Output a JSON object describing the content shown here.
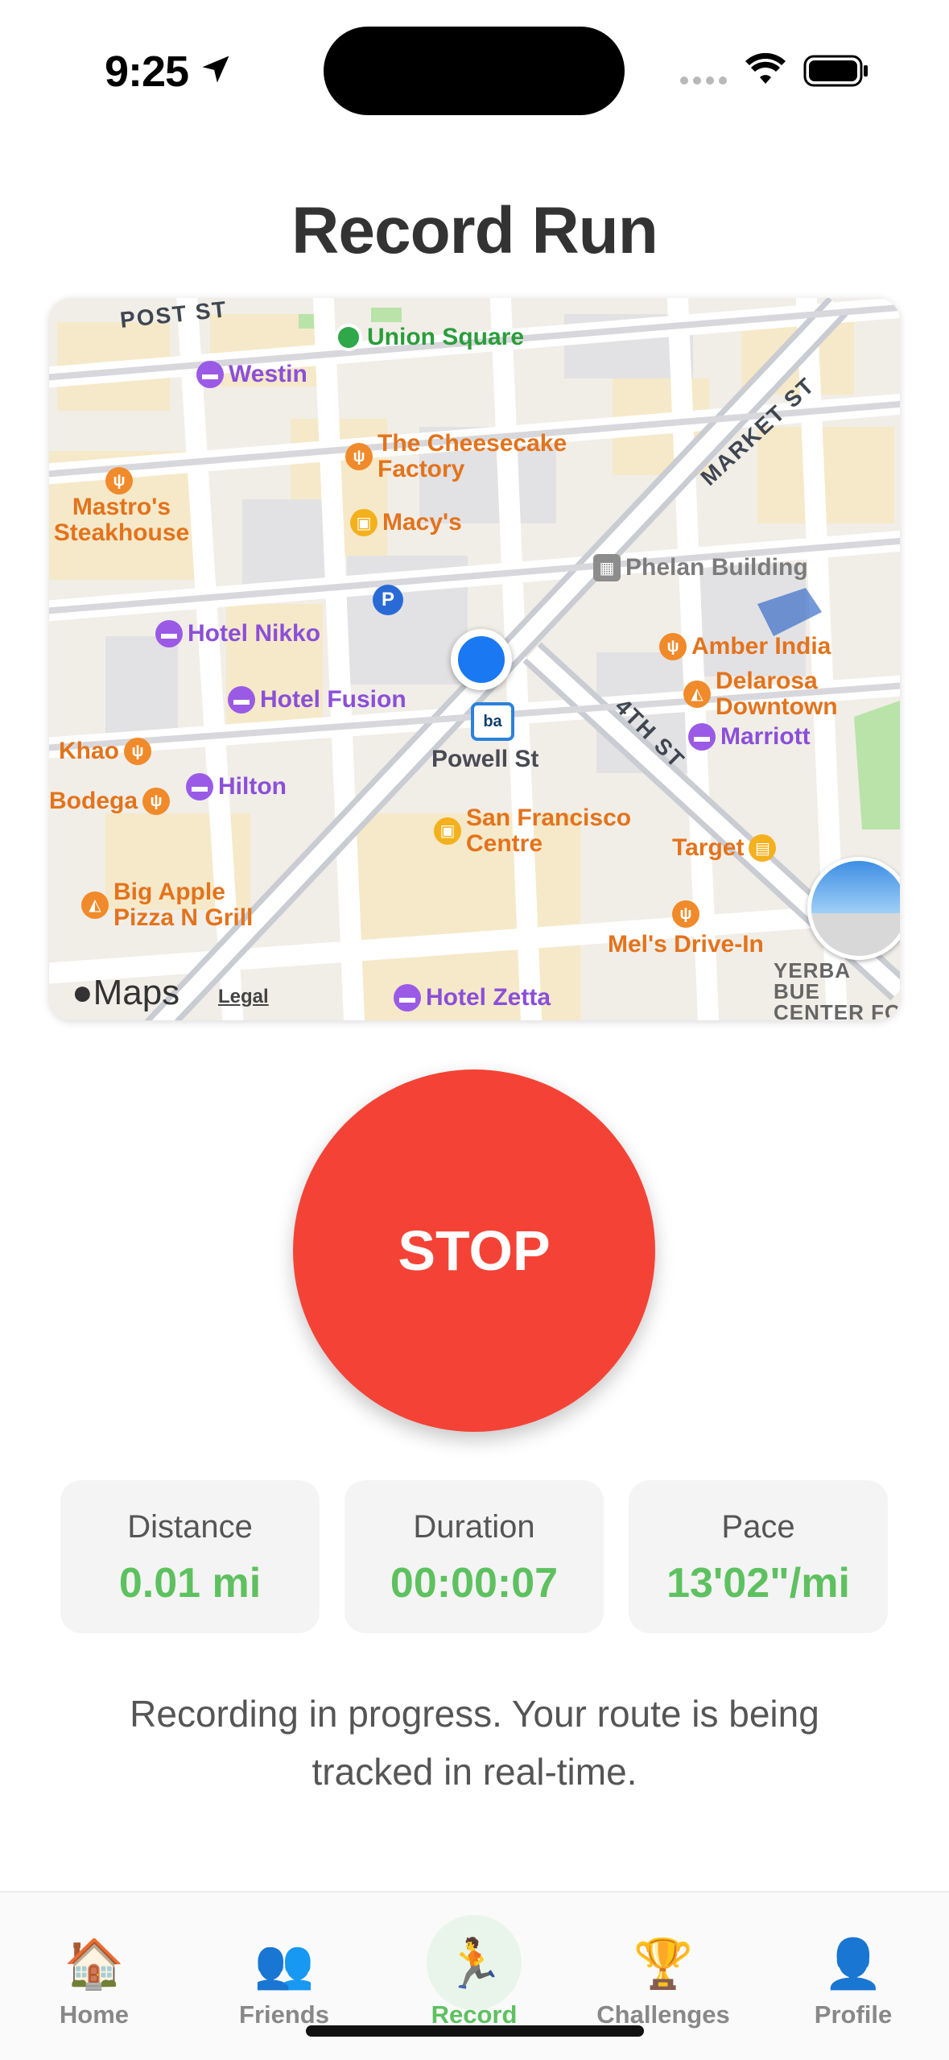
{
  "status_bar": {
    "time": "9:25"
  },
  "page": {
    "title": "Record Run"
  },
  "map": {
    "streets": [
      "POST ST",
      "MARKET ST",
      "4TH ST"
    ],
    "pois": [
      {
        "key": "union",
        "name": "Union Square"
      },
      {
        "key": "westin",
        "name": "Westin"
      },
      {
        "key": "cheesecake",
        "name": "The Cheesecake Factory"
      },
      {
        "key": "mastros",
        "name": "Mastro's Steakhouse"
      },
      {
        "key": "macys",
        "name": "Macy's"
      },
      {
        "key": "phelan",
        "name": "Phelan Building"
      },
      {
        "key": "nikko",
        "name": "Hotel Nikko"
      },
      {
        "key": "amber",
        "name": "Amber India"
      },
      {
        "key": "fusion",
        "name": "Hotel Fusion"
      },
      {
        "key": "delarosa",
        "name": "Delarosa Downtown"
      },
      {
        "key": "marriott",
        "name": "Marriott"
      },
      {
        "key": "khao",
        "name": "Khao"
      },
      {
        "key": "bodega",
        "name": "Bodega"
      },
      {
        "key": "hilton",
        "name": "Hilton"
      },
      {
        "key": "sfcentre",
        "name": "San Francisco Centre"
      },
      {
        "key": "target",
        "name": "Target"
      },
      {
        "key": "bigapple",
        "name": "Big Apple Pizza N Grill"
      },
      {
        "key": "mels",
        "name": "Mel's Drive-In"
      },
      {
        "key": "zetta",
        "name": "Hotel Zetta"
      },
      {
        "key": "yerba",
        "name": "YERBA BUE CENTER FO THE ART"
      }
    ],
    "transit_station": "Powell St",
    "transit_badge": "ba",
    "parking": "P",
    "attribution": "Maps",
    "legal": "Legal"
  },
  "stop_button": {
    "label": "STOP",
    "color": "#f44336"
  },
  "stats": [
    {
      "label": "Distance",
      "value": "0.01 mi"
    },
    {
      "label": "Duration",
      "value": "00:00:07"
    },
    {
      "label": "Pace",
      "value": "13'02\"/mi"
    }
  ],
  "status_message": "Recording in progress. Your route is being tracked in real-time.",
  "tabs": [
    {
      "label": "Home",
      "icon": "house-icon",
      "glyph": "🏠",
      "active": false
    },
    {
      "label": "Friends",
      "icon": "people-icon",
      "glyph": "👥",
      "active": false
    },
    {
      "label": "Record",
      "icon": "runner-icon",
      "glyph": "🏃",
      "active": true
    },
    {
      "label": "Challenges",
      "icon": "trophy-icon",
      "glyph": "🏆",
      "active": false
    },
    {
      "label": "Profile",
      "icon": "person-icon",
      "glyph": "👤",
      "active": false
    }
  ],
  "colors": {
    "accent": "#5ec160",
    "stop": "#f44336",
    "stat_bg": "#f4f4f4"
  }
}
